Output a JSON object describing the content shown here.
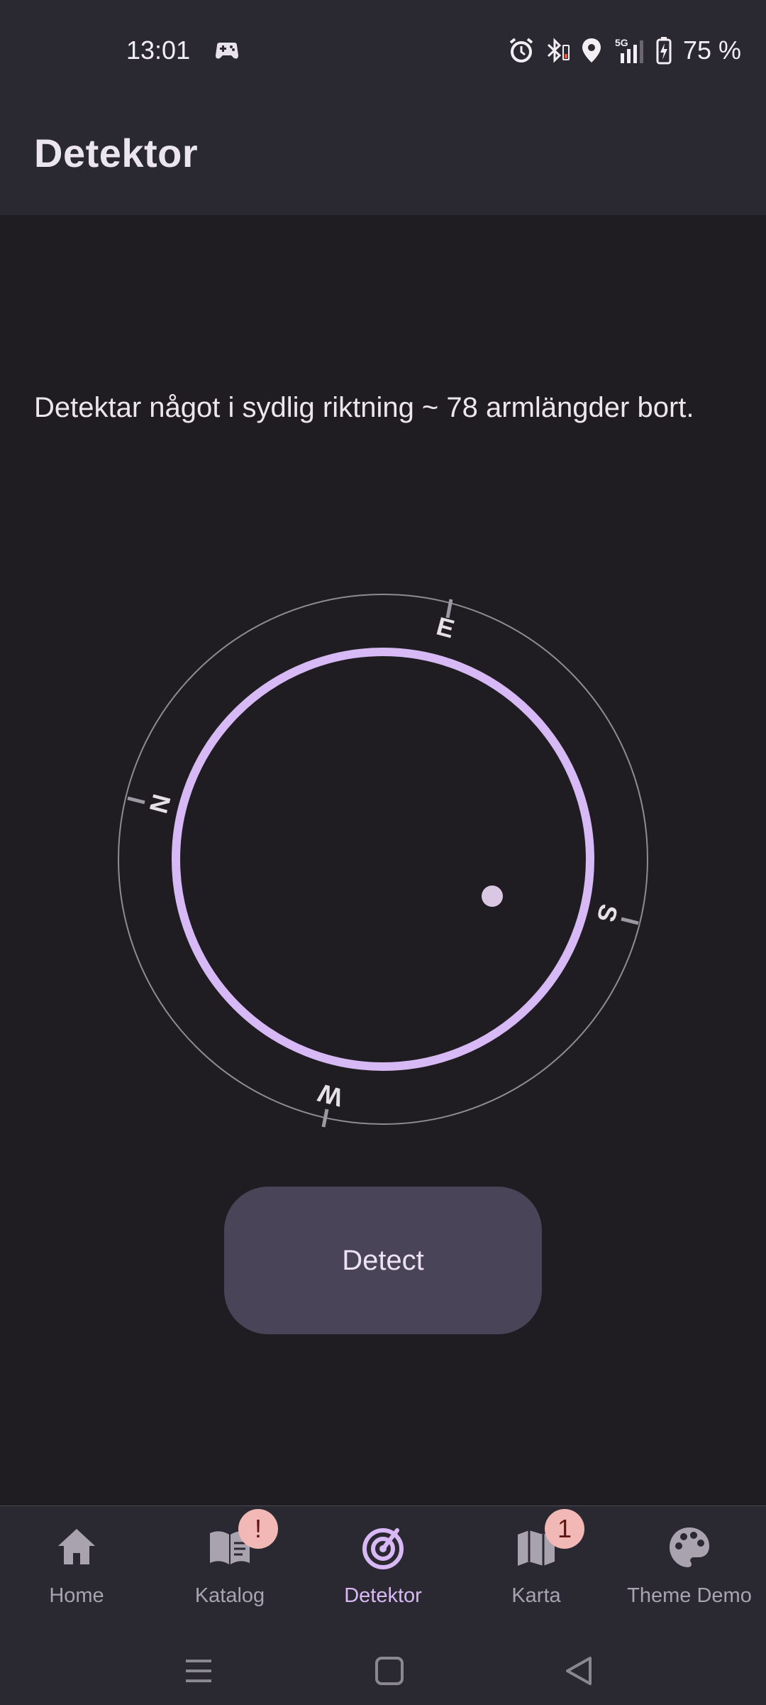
{
  "status_bar": {
    "time": "13:01",
    "battery": "75 %",
    "icons": [
      "game-controller-icon",
      "alarm-icon",
      "bluetooth-icon",
      "location-icon",
      "5g-signal-icon",
      "battery-charging-icon"
    ]
  },
  "app_bar": {
    "title": "Detektor"
  },
  "detection": {
    "message": "Detektar något i sydlig riktning  ~ 78 armlängder bort."
  },
  "compass": {
    "labels": {
      "north": "N",
      "east": "E",
      "south": "S",
      "west": "W"
    },
    "ring_color": "#d7b9f6",
    "dot_color": "#d9c7e3"
  },
  "detect_button": {
    "label": "Detect"
  },
  "bottom_nav": {
    "items": [
      {
        "label": "Home",
        "icon": "home-icon",
        "badge": ""
      },
      {
        "label": "Katalog",
        "icon": "book-icon",
        "badge": "!"
      },
      {
        "label": "Detektor",
        "icon": "radar-icon",
        "badge": "",
        "active": true
      },
      {
        "label": "Karta",
        "icon": "map-icon",
        "badge": "1"
      },
      {
        "label": "Theme Demo",
        "icon": "palette-icon",
        "badge": ""
      }
    ]
  },
  "colors": {
    "background": "#1f1d21",
    "surface": "#2a2831",
    "accent": "#d7b9f6",
    "button": "#4a4458",
    "badge": "#f2b8b5"
  }
}
